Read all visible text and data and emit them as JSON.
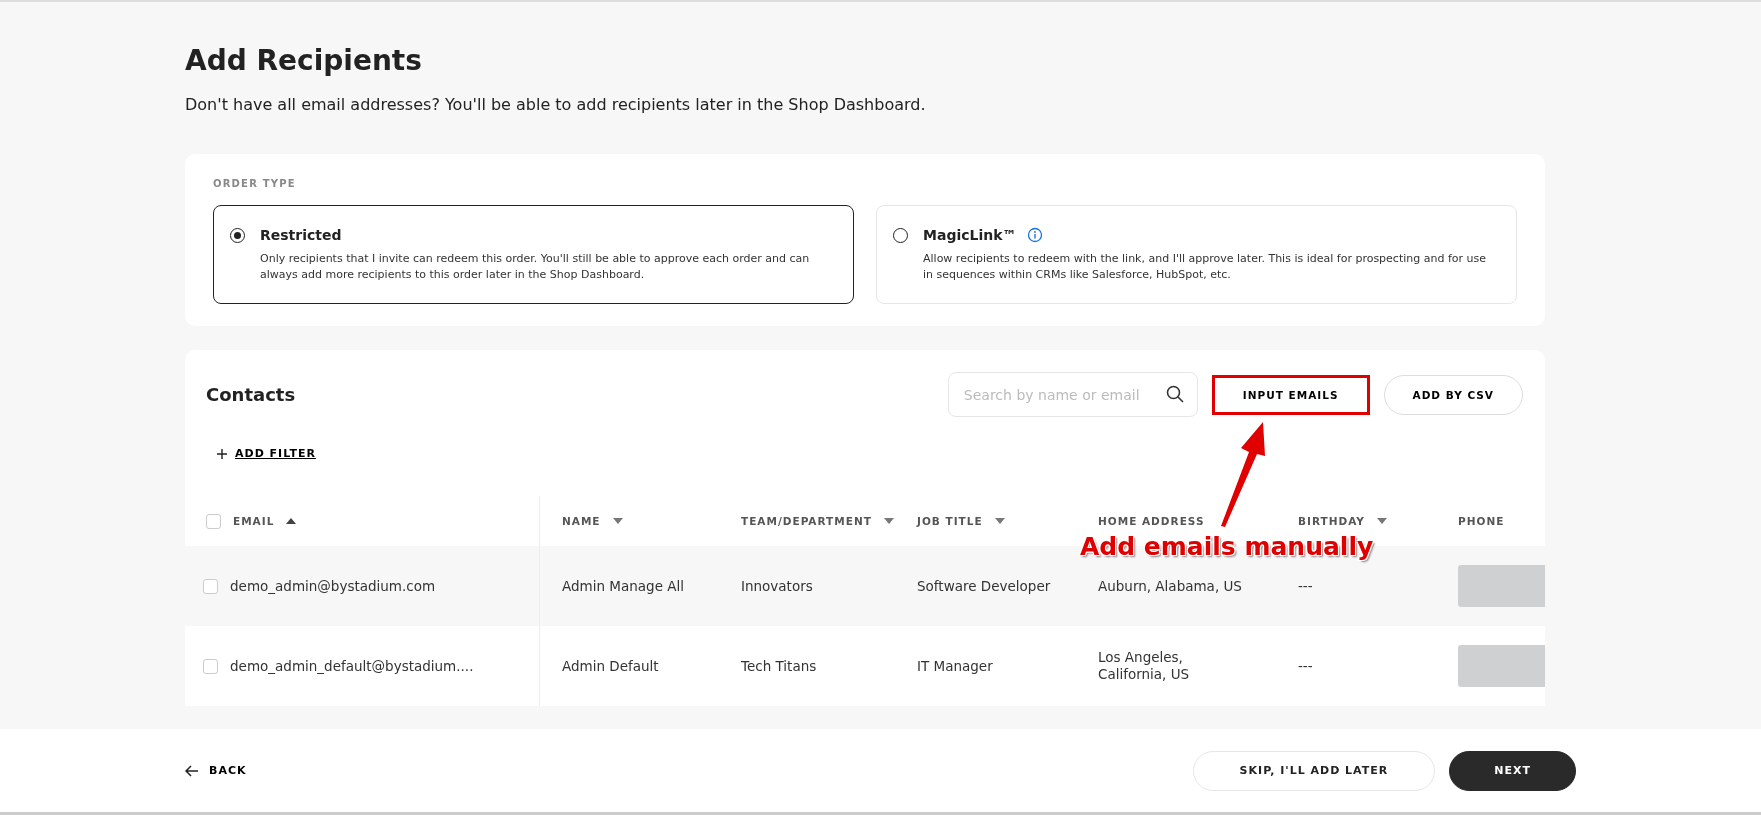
{
  "page": {
    "title": "Add Recipients",
    "subtitle": "Don't have all email addresses? You'll be able to add recipients later in the Shop Dashboard."
  },
  "order_type": {
    "label": "ORDER TYPE",
    "options": [
      {
        "title": "Restricted",
        "description": "Only recipients that I invite can redeem this order. You'll still be able to approve each order and can always add more recipients to this order later in the Shop Dashboard.",
        "selected": true,
        "info": false
      },
      {
        "title": "MagicLink™",
        "description": "Allow recipients to redeem with the link, and I'll approve later. This is ideal for prospecting and for use in sequences within CRMs like Salesforce, HubSpot, etc.",
        "selected": false,
        "info": true
      }
    ]
  },
  "contacts": {
    "title": "Contacts",
    "search": {
      "placeholder": "Search by name or email"
    },
    "buttons": [
      {
        "label": "INPUT EMAILS",
        "highlighted": true
      },
      {
        "label": "ADD BY CSV",
        "highlighted": false
      }
    ],
    "add_filter": "ADD FILTER",
    "annotation": "Add emails manually",
    "table": {
      "select_all_checked": false,
      "columns": [
        {
          "label": "EMAIL",
          "sort_arrow": true,
          "ascending": true
        },
        {
          "label": "NAME",
          "sort_arrow": true,
          "ascending": false
        },
        {
          "label": "TEAM/DEPARTMENT",
          "sort_arrow": true,
          "ascending": false
        },
        {
          "label": "JOB TITLE",
          "sort_arrow": true,
          "ascending": false
        },
        {
          "label": "HOME ADDRESS",
          "sort_arrow": false
        },
        {
          "label": "BIRTHDAY",
          "sort_arrow": true,
          "ascending": false
        },
        {
          "label": "PHONE",
          "sort_arrow": false
        }
      ],
      "rows": [
        {
          "checked": false,
          "cells": [
            "demo_admin@bystadium.com",
            "Admin Manage All",
            "Innovators",
            "Software Developer",
            "Auburn, Alabama, US",
            "---"
          ],
          "phone_redacted": true
        },
        {
          "checked": false,
          "cells": [
            "demo_admin_default@bystadium....",
            "Admin Default",
            "Tech Titans",
            "IT Manager",
            "Los Angeles, California, US",
            "---"
          ],
          "phone_redacted": true
        }
      ]
    }
  },
  "footer": {
    "back": "BACK",
    "skip": "SKIP, I'LL ADD LATER",
    "next": "NEXT"
  }
}
